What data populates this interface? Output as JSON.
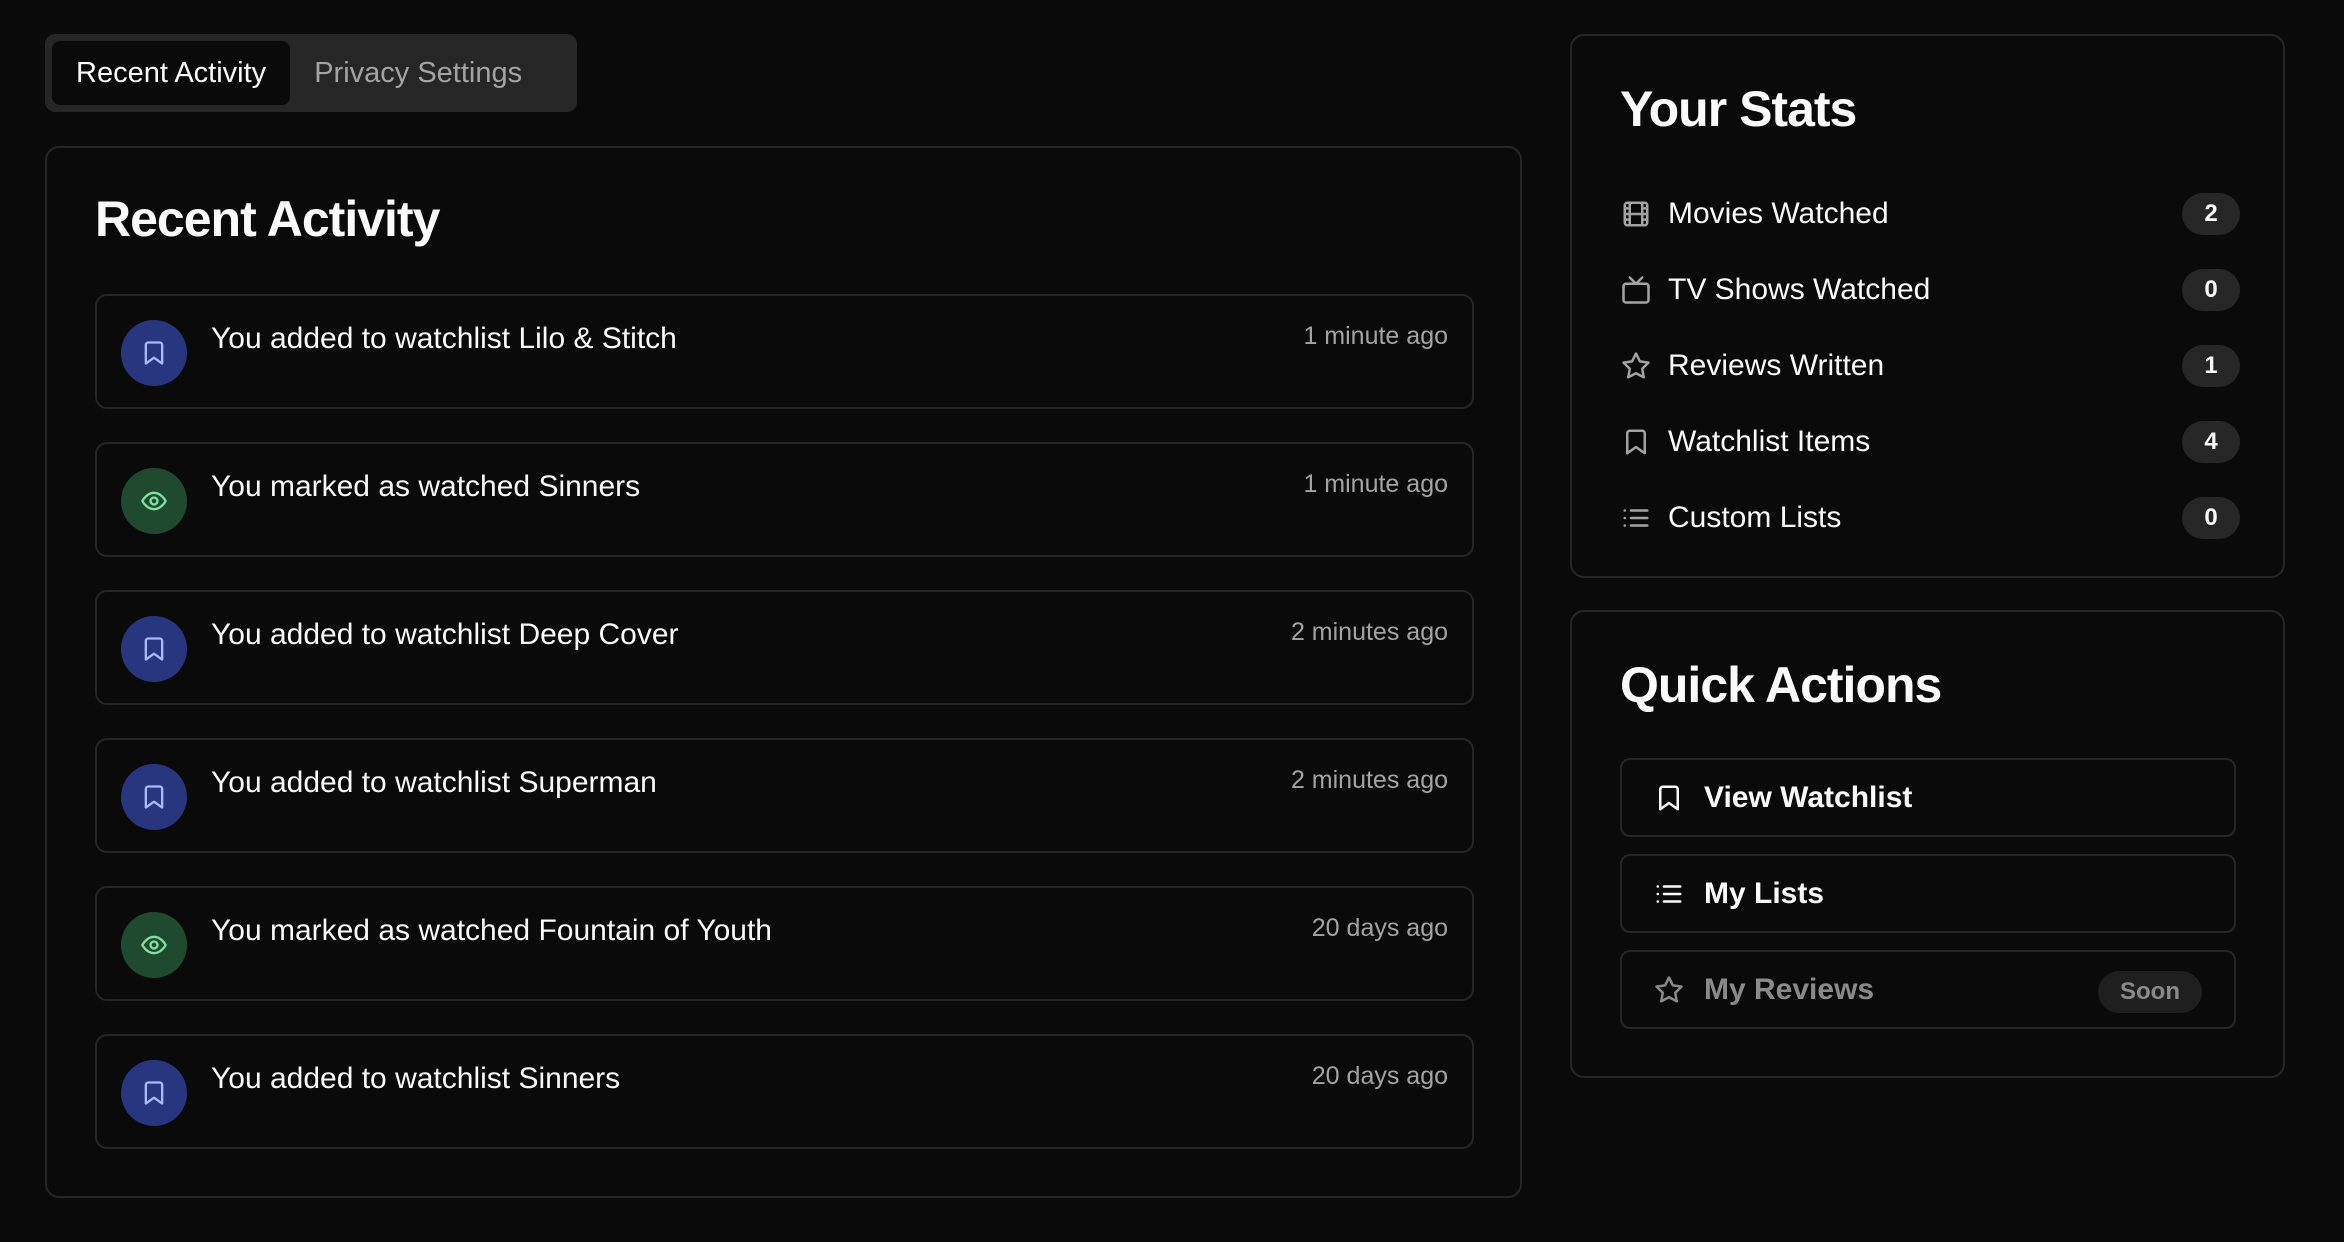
{
  "tabs": [
    {
      "label": "Recent Activity",
      "active": true
    },
    {
      "label": "Privacy Settings",
      "active": false
    }
  ],
  "activity": {
    "title": "Recent Activity",
    "items": [
      {
        "type": "watchlist",
        "icon": "bookmark-icon",
        "prefix": "You added to watchlist",
        "subject": "Lilo & Stitch",
        "time": "1 minute ago"
      },
      {
        "type": "watched",
        "icon": "eye-icon",
        "prefix": "You marked as watched",
        "subject": "Sinners",
        "time": "1 minute ago"
      },
      {
        "type": "watchlist",
        "icon": "bookmark-icon",
        "prefix": "You added to watchlist",
        "subject": "Deep Cover",
        "time": "2 minutes ago"
      },
      {
        "type": "watchlist",
        "icon": "bookmark-icon",
        "prefix": "You added to watchlist",
        "subject": "Superman",
        "time": "2 minutes ago"
      },
      {
        "type": "watched",
        "icon": "eye-icon",
        "prefix": "You marked as watched",
        "subject": "Fountain of Youth",
        "time": "20 days ago"
      },
      {
        "type": "watchlist",
        "icon": "bookmark-icon",
        "prefix": "You added to watchlist",
        "subject": "Sinners",
        "time": "20 days ago"
      }
    ]
  },
  "stats": {
    "title": "Your Stats",
    "items": [
      {
        "icon": "film-icon",
        "label": "Movies Watched",
        "value": "2"
      },
      {
        "icon": "tv-icon",
        "label": "TV Shows Watched",
        "value": "0"
      },
      {
        "icon": "star-icon",
        "label": "Reviews Written",
        "value": "1"
      },
      {
        "icon": "bookmark-icon",
        "label": "Watchlist Items",
        "value": "4"
      },
      {
        "icon": "list-icon",
        "label": "Custom Lists",
        "value": "0"
      }
    ]
  },
  "quick_actions": {
    "title": "Quick Actions",
    "items": [
      {
        "icon": "bookmark-icon",
        "label": "View Watchlist",
        "disabled": false
      },
      {
        "icon": "list-icon",
        "label": "My Lists",
        "disabled": false
      },
      {
        "icon": "star-icon",
        "label": "My Reviews",
        "disabled": true,
        "badge": "Soon"
      }
    ]
  },
  "colors": {
    "background": "#0a0a0a",
    "border": "#262626",
    "watchlist_accent": "#28357f",
    "watched_accent": "#1f4a30",
    "muted_text": "#a3a3a3"
  }
}
